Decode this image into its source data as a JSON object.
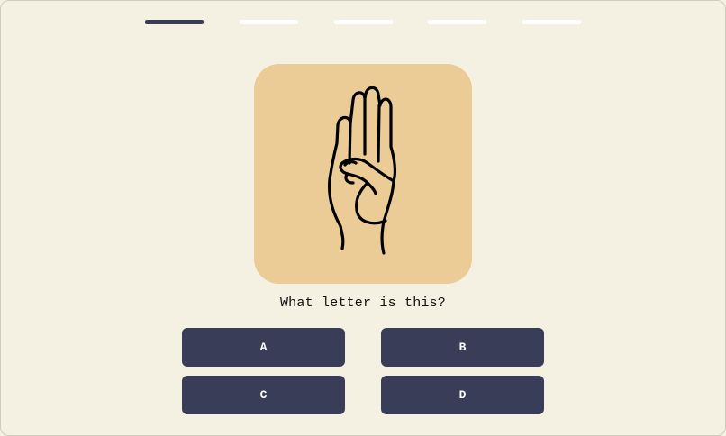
{
  "progress": {
    "current_step": 1,
    "total_steps": 5,
    "active_color": "#3a3d58",
    "inactive_color": "#ffffff"
  },
  "card": {
    "image_icon": "asl-hand-sign-b-icon",
    "background_color": "#ebcb96"
  },
  "question": "What letter is this?",
  "answers": [
    {
      "label": "A"
    },
    {
      "label": "B"
    },
    {
      "label": "C"
    },
    {
      "label": "D"
    }
  ],
  "colors": {
    "page_background": "#f4f1e2",
    "button_color": "#3a3d58"
  }
}
